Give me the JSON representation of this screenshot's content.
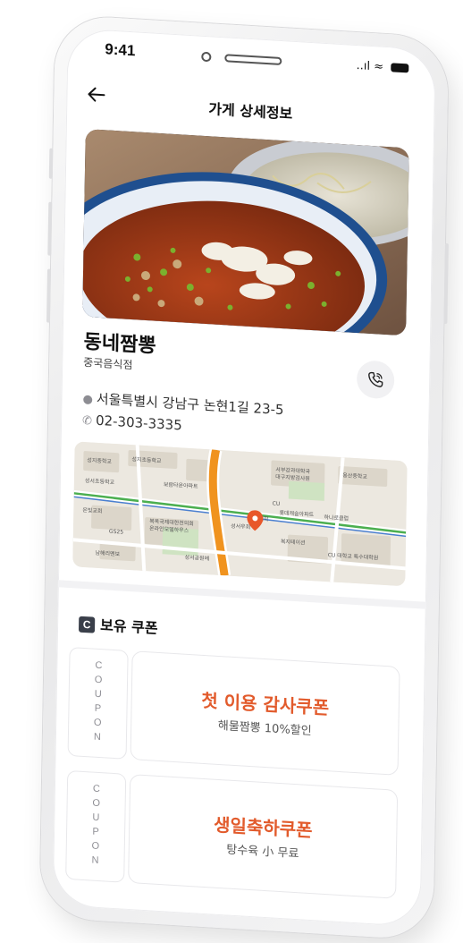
{
  "status": {
    "time": "9:41",
    "signal": "..ıl"
  },
  "header": {
    "back_icon": "arrow-left-icon",
    "title": "가게 상세정보"
  },
  "store": {
    "name": "동네짬뽕",
    "category": "중국음식점",
    "address": "서울특별시 강남구 논현1길 23-5",
    "phone": "02-303-3335"
  },
  "map": {
    "labels": [
      "성지중학교",
      "성지초등학교",
      "성서초등학교",
      "보람타운아파트",
      "서부강과대학국",
      "대구지방검사원",
      "용산중학교",
      "은빛교회",
      "복옥국제대한전의회",
      "온라인모델하우스",
      "CU",
      "롯데캐슬아파트",
      "하나로클럽",
      "성서우회",
      "주렘대학",
      "GS25",
      "남해리멘보",
      "복지테이션",
      "성서공원메",
      "CU 대학교 특수대학원"
    ],
    "accent": "#e8572a"
  },
  "coupons_section": {
    "badge": "C",
    "title": "보유 쿠폰"
  },
  "coupons": [
    {
      "stub": "COUPON",
      "title": "첫 이용 감사쿠폰",
      "subtitle": "해물짬뽕 10%할인"
    },
    {
      "stub": "COUPON",
      "title": "생일축하쿠폰",
      "subtitle": "탕수육 小 무료"
    }
  ],
  "colors": {
    "accent": "#e25b2c",
    "text": "#111111",
    "muted": "#8d8d93"
  }
}
